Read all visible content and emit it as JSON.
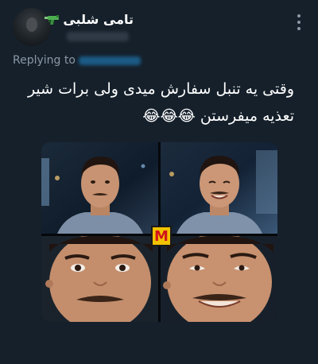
{
  "author": {
    "display_name": "تامی شلبی",
    "badge_icon": "water-gun-icon",
    "avatar_icon": "profile-avatar"
  },
  "reply": {
    "prefix": "Replying to"
  },
  "tweet": {
    "text_line1": "وقتی یه تنبل سفارش میدی ولی برات شیر",
    "text_line2": "تعذیه میفرستن 😂😂😂"
  },
  "media": {
    "logo_letter": "M",
    "panels": [
      "face-neutral-panel",
      "face-smile-panel",
      "face-closeup-neutral-panel",
      "face-closeup-smile-panel"
    ]
  },
  "colors": {
    "background": "#15202b",
    "secondary_text": "#8b98a5",
    "link": "#1d9bf0",
    "logo_yellow": "#f2c200",
    "logo_red": "#d1141b"
  }
}
